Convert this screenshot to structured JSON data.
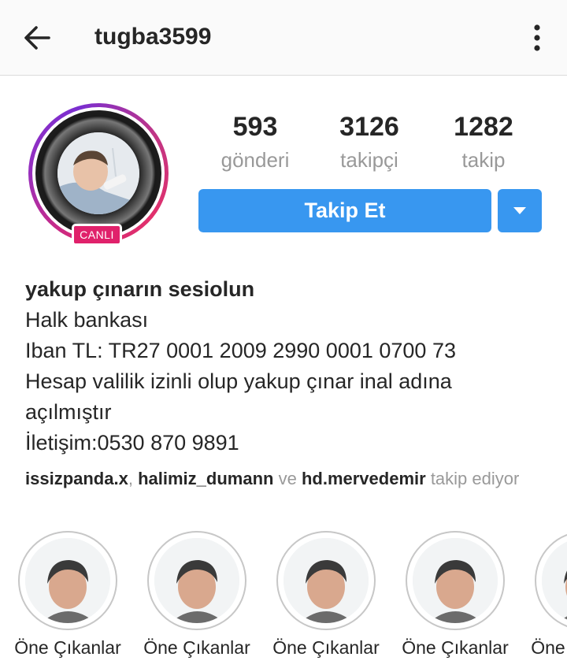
{
  "header": {
    "username": "tugba3599"
  },
  "profile": {
    "live_badge": "CANLI",
    "stats": [
      {
        "value": "593",
        "label": "gönderi"
      },
      {
        "value": "3126",
        "label": "takipçi"
      },
      {
        "value": "1282",
        "label": "takip"
      }
    ],
    "follow_label": "Takip Et",
    "accent_color": "#3897f0",
    "live_color": "#e0216b"
  },
  "bio": {
    "name": "yakup çınarın sesiolun",
    "lines": [
      "Halk bankası",
      "Iban TL: TR27 0001 2009 2990 0001 0700 73",
      "Hesap valilik izinli olup yakup çınar inal adına açılmıştır",
      "İletişim:0530 870 9891"
    ]
  },
  "followed_by": {
    "users": [
      "issizpanda.x",
      "halimiz_dumann",
      "hd.mervedemir"
    ],
    "separator": ",",
    "and_word": "ve",
    "suffix": "takip ediyor"
  },
  "highlights": [
    {
      "label": "Öne Çıkanlar"
    },
    {
      "label": "Öne Çıkanlar"
    },
    {
      "label": "Öne Çıkanlar"
    },
    {
      "label": "Öne Çıkanlar"
    },
    {
      "label": "Öne Çıkanlar"
    }
  ],
  "icons": {
    "back": "arrow-left-icon",
    "more": "vertical-dots-icon",
    "dropdown": "caret-down-icon"
  }
}
